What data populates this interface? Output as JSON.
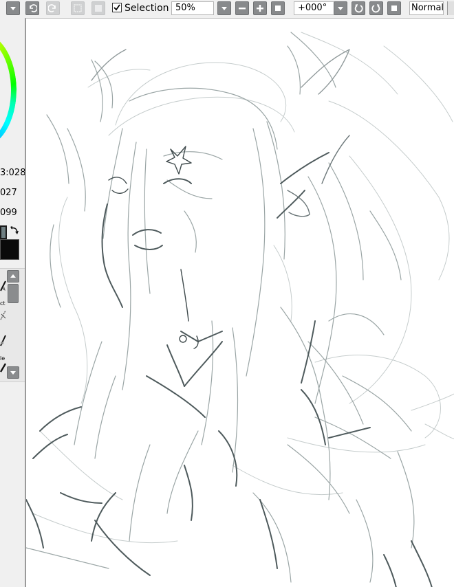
{
  "toolbar": {
    "selection_checked": true,
    "selection_label": "Selection",
    "zoom_value": "50%",
    "rotation_value": "+000°",
    "blend_mode": "Normal",
    "buttons": [
      {
        "icon": "dropdown-icon"
      },
      {
        "icon": "undo-icon"
      },
      {
        "icon": "redo-icon",
        "disabled": true
      },
      {
        "icon": "deselect-icon",
        "disabled": true
      },
      {
        "icon": "invert-selection-icon",
        "disabled": true
      },
      {
        "icon": "zoom-dropdown-icon"
      },
      {
        "icon": "zoom-out-icon"
      },
      {
        "icon": "zoom-in-icon"
      },
      {
        "icon": "zoom-reset-icon"
      },
      {
        "icon": "rotation-dropdown-icon"
      },
      {
        "icon": "rotate-ccw-icon"
      },
      {
        "icon": "rotate-cw-icon"
      },
      {
        "icon": "rotation-reset-icon"
      }
    ]
  },
  "left_panel": {
    "color_wheel": "hsv-color-wheel",
    "coordinates": [
      "3:028",
      "027",
      "099"
    ],
    "foreground_color": "#6f7f82",
    "background_color": "#0a0a0a",
    "tool_labels": [
      "ct",
      "le"
    ]
  },
  "canvas": {
    "content": "sketch"
  }
}
